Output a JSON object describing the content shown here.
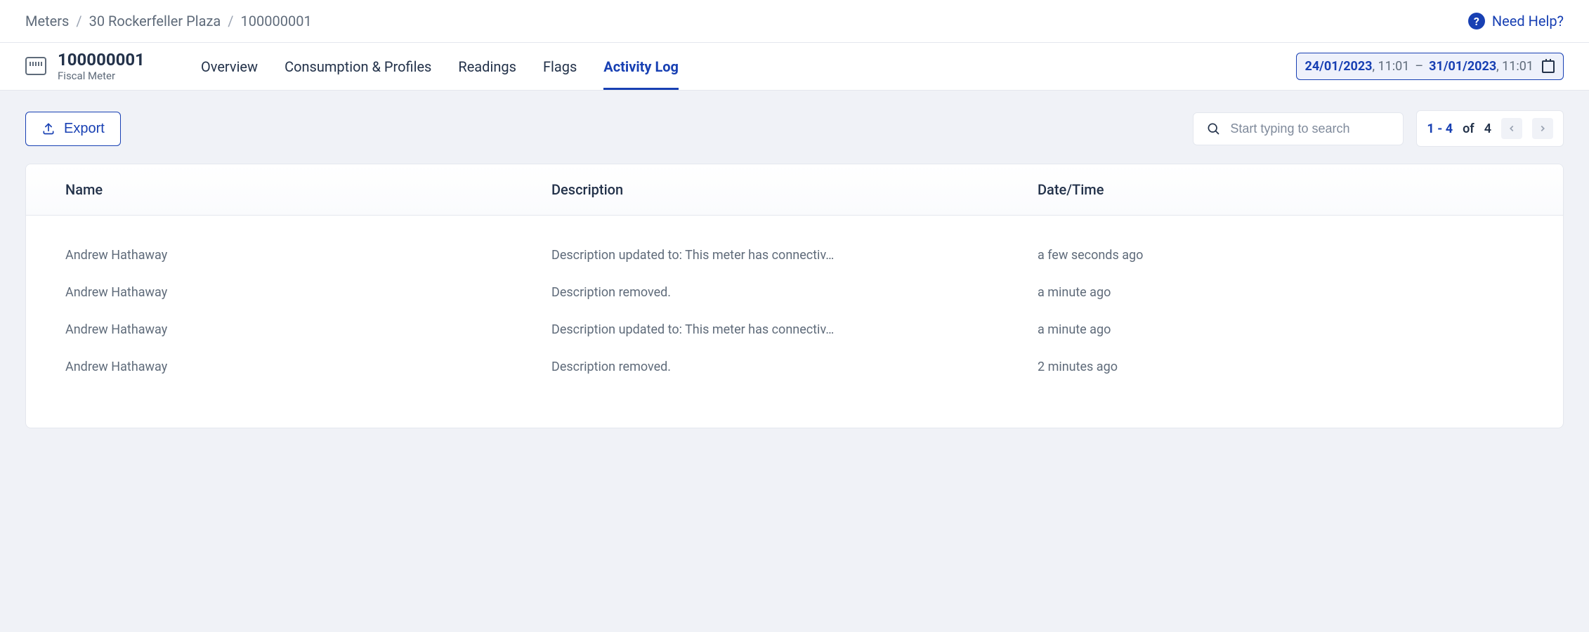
{
  "breadcrumbs": {
    "items": [
      {
        "label": "Meters"
      },
      {
        "label": "30 Rockerfeller Plaza"
      },
      {
        "label": "100000001"
      }
    ]
  },
  "help": {
    "label": "Need Help?"
  },
  "meter": {
    "title": "100000001",
    "subtitle": "Fiscal Meter"
  },
  "tabs": [
    {
      "label": "Overview"
    },
    {
      "label": "Consumption & Profiles"
    },
    {
      "label": "Readings"
    },
    {
      "label": "Flags"
    },
    {
      "label": "Activity Log"
    }
  ],
  "date_range": {
    "from_date": "24/01/2023",
    "from_time": "11:01",
    "to_date": "31/01/2023",
    "to_time": "11:01"
  },
  "toolbar": {
    "export_label": "Export",
    "search_placeholder": "Start typing to search",
    "pagination": {
      "range": "1 - 4",
      "of_label": "of",
      "total": "4"
    }
  },
  "table": {
    "columns": [
      "Name",
      "Description",
      "Date/Time"
    ],
    "rows": [
      {
        "name": "Andrew Hathaway",
        "description": "Description updated to: This meter has connectiv…",
        "datetime": "a few seconds ago"
      },
      {
        "name": "Andrew Hathaway",
        "description": "Description removed.",
        "datetime": "a minute ago"
      },
      {
        "name": "Andrew Hathaway",
        "description": "Description updated to: This meter has connectiv…",
        "datetime": "a minute ago"
      },
      {
        "name": "Andrew Hathaway",
        "description": "Description removed.",
        "datetime": "2 minutes ago"
      }
    ]
  }
}
